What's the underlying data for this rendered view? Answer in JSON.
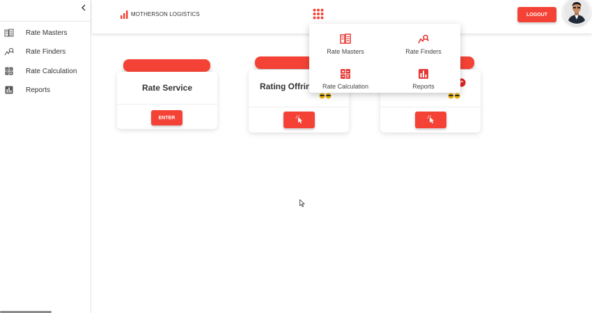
{
  "sidebar": {
    "items": [
      {
        "label": "Rate Masters",
        "icon": "rate-masters-icon"
      },
      {
        "label": "Rate Finders",
        "icon": "rate-finders-icon"
      },
      {
        "label": "Rate Calculation",
        "icon": "calculator-icon"
      },
      {
        "label": "Reports",
        "icon": "reports-icon"
      }
    ]
  },
  "header": {
    "brand": "MOTHERSON LOGISTICS",
    "logout_label": "LOGOUT"
  },
  "cards": [
    {
      "title": "Rate Service",
      "button_label": "ENTER"
    },
    {
      "title": "Rating Offring"
    }
  ],
  "apps_menu": {
    "items": [
      {
        "label": "Rate Masters",
        "icon": "rate-masters-icon"
      },
      {
        "label": "Rate Finders",
        "icon": "rate-finders-icon"
      },
      {
        "label": "Rate Calculation",
        "icon": "calculator-icon"
      },
      {
        "label": "Reports",
        "icon": "reports-icon"
      }
    ]
  },
  "colors": {
    "accent": "#f44336",
    "sidebar_icon": "#555555"
  }
}
